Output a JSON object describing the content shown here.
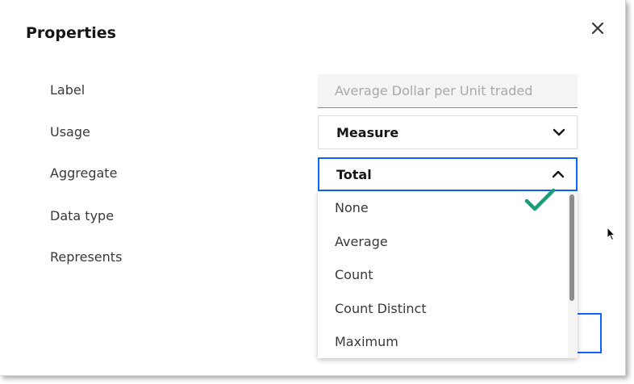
{
  "dialog": {
    "title": "Properties",
    "close_icon": "close-icon"
  },
  "fields": {
    "label": {
      "label": "Label",
      "placeholder": "Average Dollar per Unit traded"
    },
    "usage": {
      "label": "Usage",
      "value": "Measure"
    },
    "aggregate": {
      "label": "Aggregate",
      "value": "Total"
    },
    "data_type": {
      "label": "Data type"
    },
    "represents": {
      "label": "Represents"
    }
  },
  "aggregate_options": [
    "None",
    "Average",
    "Count",
    "Count Distinct",
    "Maximum"
  ],
  "colors": {
    "accent": "#0f62fe",
    "check": "#1a9e77",
    "text_primary": "#161616",
    "text_secondary": "#393939",
    "field_bg": "#f4f4f4"
  },
  "icons": {
    "chevron_down": "chevron-down-icon",
    "chevron_up": "chevron-up-icon",
    "checkmark": "checkmark-icon",
    "cursor": "mouse-pointer-icon"
  }
}
